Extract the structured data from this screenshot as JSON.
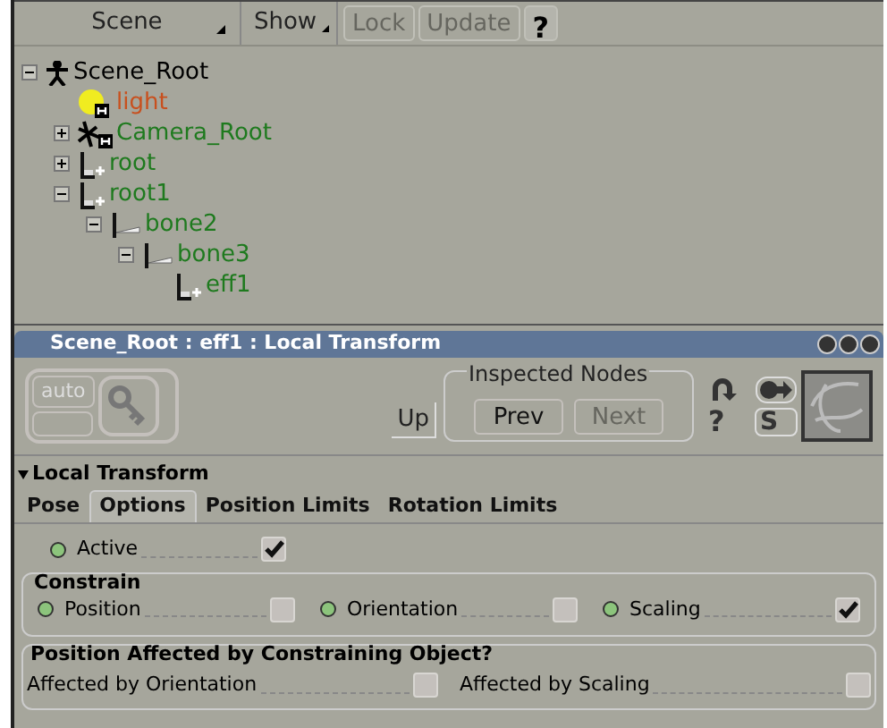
{
  "toolbar": {
    "scene_menu": "Scene",
    "show_menu": "Show",
    "buttons": [
      {
        "label": "Lock",
        "disabled": true
      },
      {
        "label": "Update",
        "disabled": true
      },
      {
        "label": "?",
        "disabled": false
      }
    ]
  },
  "tree": [
    {
      "label": "Scene_Root",
      "kind": "model",
      "color": "#000000",
      "expanded": true,
      "children": [
        {
          "label": "light",
          "kind": "light",
          "color": "#c8501e"
        },
        {
          "label": "Camera_Root",
          "kind": "camera",
          "color": "#1e7a1e",
          "expanded": false
        },
        {
          "label": "root",
          "kind": "chain",
          "color": "#1e7a1e",
          "expanded": false
        },
        {
          "label": "root1",
          "kind": "chain",
          "color": "#1e7a1e",
          "expanded": true,
          "children": [
            {
              "label": "bone2",
              "kind": "bone",
              "color": "#1e7a1e",
              "expanded": true,
              "children": [
                {
                  "label": "bone3",
                  "kind": "bone",
                  "color": "#1e7a1e",
                  "expanded": true,
                  "children": [
                    {
                      "label": "eff1",
                      "kind": "chain",
                      "color": "#1e7a1e"
                    }
                  ]
                }
              ]
            }
          ]
        }
      ]
    }
  ],
  "property_panel": {
    "title": "Scene_Root : eff1 : Local Transform",
    "auto_label": "auto",
    "up_button": "Up",
    "inspected_nodes": {
      "label": "Inspected Nodes",
      "prev": {
        "label": "Prev",
        "disabled": false
      },
      "next": {
        "label": "Next",
        "disabled": true
      }
    },
    "side_buttons": [
      "?",
      "S"
    ]
  },
  "section": {
    "title": "Local Transform",
    "expanded": true
  },
  "tabs": [
    {
      "label": "Pose",
      "selected": false
    },
    {
      "label": "Options",
      "selected": true
    },
    {
      "label": "Position Limits",
      "selected": false
    },
    {
      "label": "Rotation Limits",
      "selected": false
    }
  ],
  "active": {
    "label": "Active",
    "animatable": true,
    "checked": true
  },
  "constrain": {
    "title": "Constrain",
    "items": [
      {
        "label": "Position",
        "animatable": true,
        "checked": false
      },
      {
        "label": "Orientation",
        "animatable": true,
        "checked": false
      },
      {
        "label": "Scaling",
        "animatable": true,
        "checked": true
      }
    ]
  },
  "affected": {
    "title": "Position Affected by Constraining Object?",
    "items": [
      {
        "label": "Affected by Orientation",
        "animatable": false,
        "checked": false
      },
      {
        "label": "Affected by Scaling",
        "animatable": false,
        "checked": false
      }
    ]
  }
}
